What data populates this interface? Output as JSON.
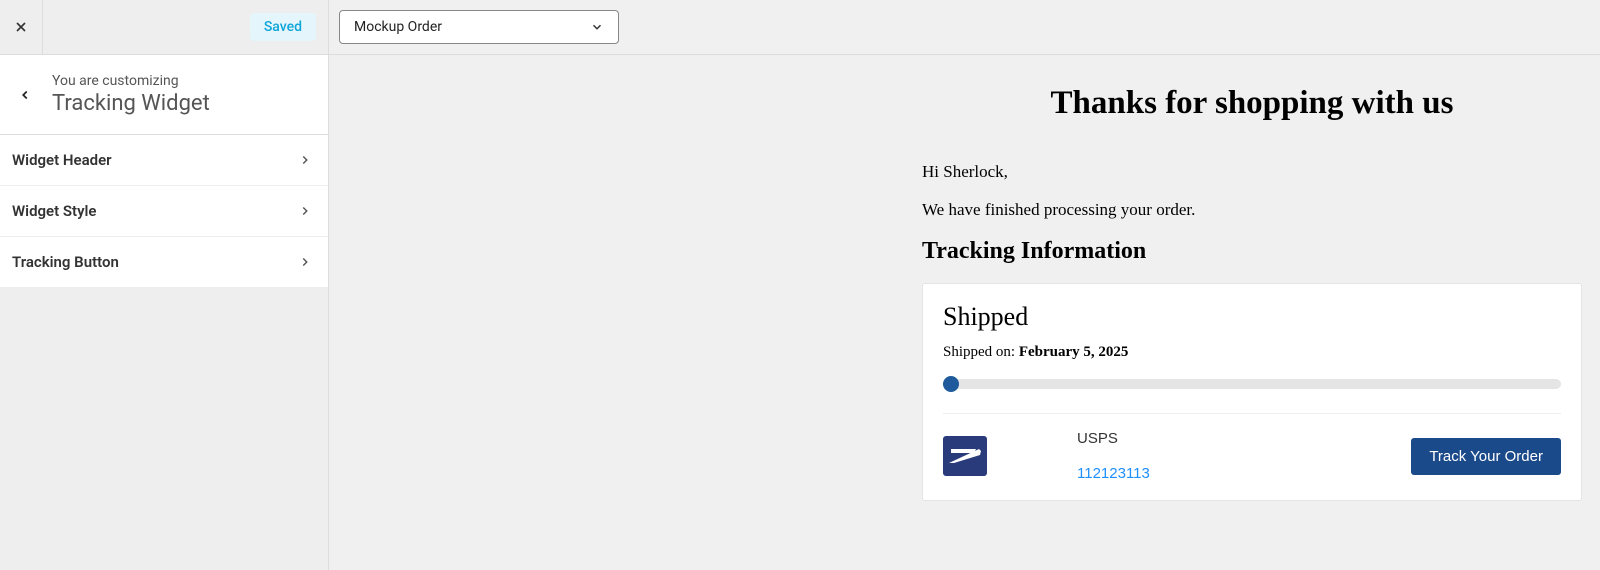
{
  "sidebar": {
    "saved_label": "Saved",
    "customizing_label": "You are customizing",
    "section_title": "Tracking Widget",
    "options": [
      {
        "label": "Widget Header"
      },
      {
        "label": "Widget Style"
      },
      {
        "label": "Tracking Button"
      }
    ]
  },
  "topbar": {
    "dropdown_value": "Mockup Order"
  },
  "email": {
    "headline": "Thanks for shopping with us",
    "greeting": "Hi Sherlock,",
    "intro": "We have finished processing your order.",
    "tracking_heading": "Tracking Information",
    "status": "Shipped",
    "shipped_on_label": "Shipped on: ",
    "shipped_date": "February 5, 2025",
    "carrier_name": "USPS",
    "tracking_number": "112123113",
    "track_button": "Track Your Order"
  }
}
